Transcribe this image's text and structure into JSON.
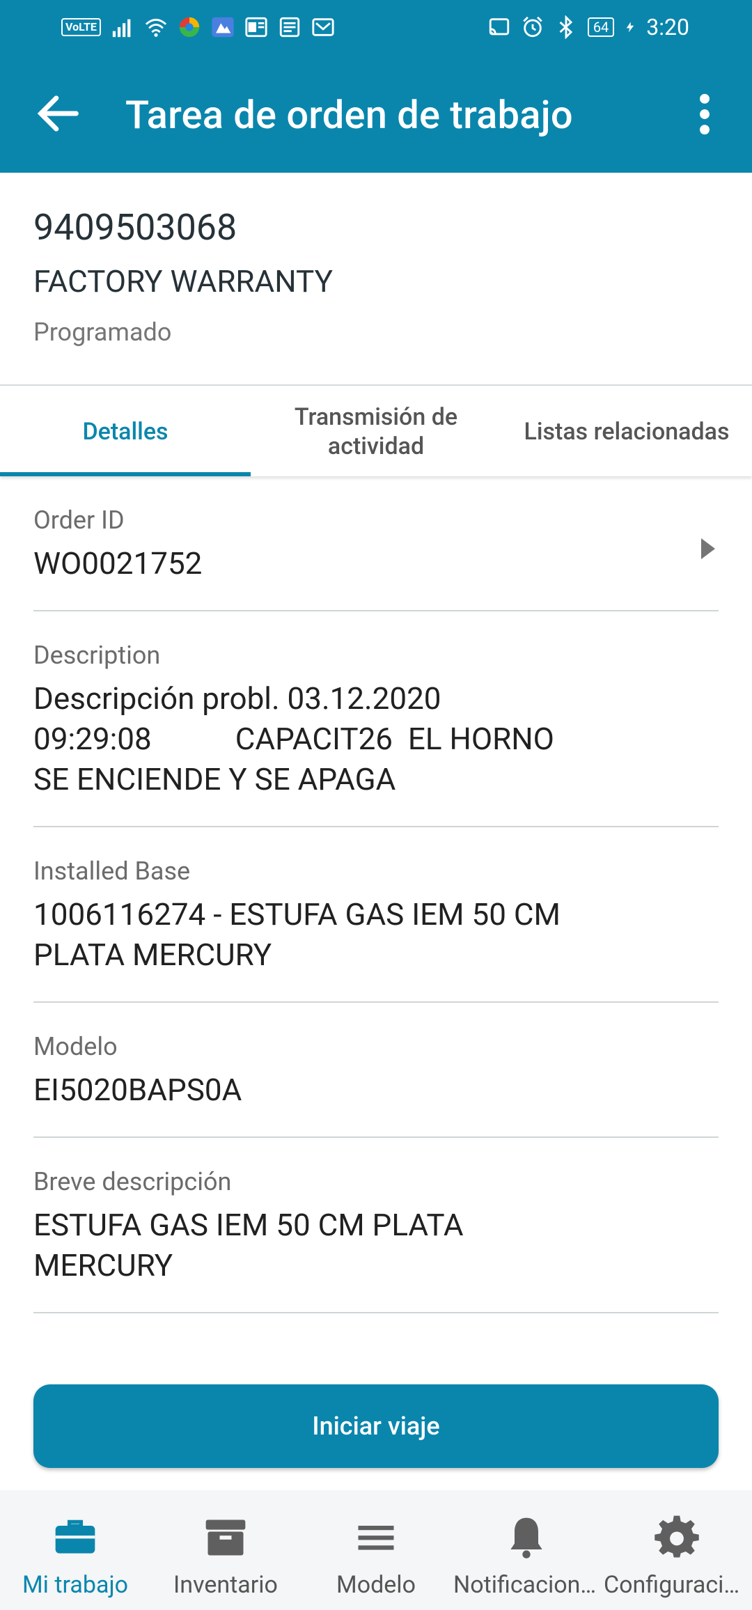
{
  "status_bar": {
    "volte": "VoLTE",
    "battery": "64",
    "time": "3:20"
  },
  "app_bar": {
    "title": "Tarea de orden de trabajo",
    "back_icon": "arrow-back-icon",
    "menu_icon": "more-vertical-icon"
  },
  "header": {
    "order_number": "9409503068",
    "order_type": "FACTORY WARRANTY",
    "status": "Programado"
  },
  "tabs": [
    {
      "label": "Detalles",
      "active": true
    },
    {
      "label": "Transmisión de actividad",
      "active": false
    },
    {
      "label": "Listas relacionadas",
      "active": false
    }
  ],
  "fields": {
    "order_id": {
      "label": "Order ID",
      "value": "WO0021752"
    },
    "description": {
      "label": "Description",
      "value": "Descripción probl. 03.12.2020\n09:29:08           CAPACIT26  EL HORNO\nSE ENCIENDE Y SE APAGA"
    },
    "installed_base": {
      "label": "Installed Base",
      "value": "1006116274 - ESTUFA GAS IEM 50 CM\nPLATA MERCURY"
    },
    "modelo": {
      "label": "Modelo",
      "value": "EI5020BAPS0A"
    },
    "breve_descripcion": {
      "label": "Breve descripción",
      "value": "ESTUFA GAS IEM 50 CM PLATA\nMERCURY"
    }
  },
  "primary_button": {
    "label": "Iniciar viaje"
  },
  "bottom_nav": [
    {
      "label": "Mi trabajo",
      "icon": "briefcase-icon",
      "active": true
    },
    {
      "label": "Inventario",
      "icon": "archive-box-icon",
      "active": false
    },
    {
      "label": "Modelo",
      "icon": "menu-lines-icon",
      "active": false
    },
    {
      "label": "Notificaciones",
      "icon": "bell-icon",
      "active": false
    },
    {
      "label": "Configuración",
      "icon": "gear-icon",
      "active": false
    }
  ],
  "colors": {
    "primary": "#0a86ad",
    "divider": "#cfd4d6",
    "label_gray": "#6b6b6b"
  }
}
